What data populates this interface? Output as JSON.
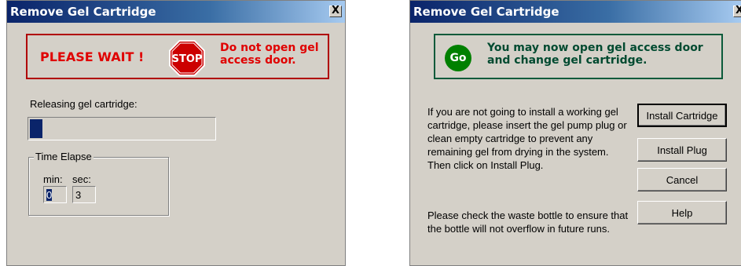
{
  "dialog_wait": {
    "title": "Remove Gel Cartridge",
    "close_glyph": "X",
    "warning_text": "PLEASE WAIT !",
    "stop_sign_text": "STOP",
    "warning_msg": "Do not open gel access door.",
    "progress_label": "Releasing gel cartridge:",
    "progress_fraction": 0.07,
    "group_label": "Time Elapse",
    "min_label": "min:",
    "sec_label": "sec:",
    "min_value": "0",
    "sec_value": "3",
    "colors": {
      "title_bar": "#0a246a",
      "alert_red": "#e00000",
      "progress_fill": "#0a246a"
    }
  },
  "dialog_go": {
    "title": "Remove Gel Cartridge",
    "close_glyph": "X",
    "go_text": "Go",
    "go_msg": "You may now open gel access door and change gel cartridge.",
    "instructions_1": "If you are not going to install a working gel cartridge, please insert the gel pump plug or clean empty cartridge to prevent any remaining gel from drying in the system. Then click on Install Plug.",
    "instructions_2": "Please check the waste bottle to ensure that the bottle will not overflow in future runs.",
    "buttons": {
      "install_cartridge": "Install Cartridge",
      "install_plug": "Install Plug",
      "cancel": "Cancel",
      "help": "Help"
    },
    "colors": {
      "go_green": "#008000",
      "go_text": "#004a30"
    }
  }
}
